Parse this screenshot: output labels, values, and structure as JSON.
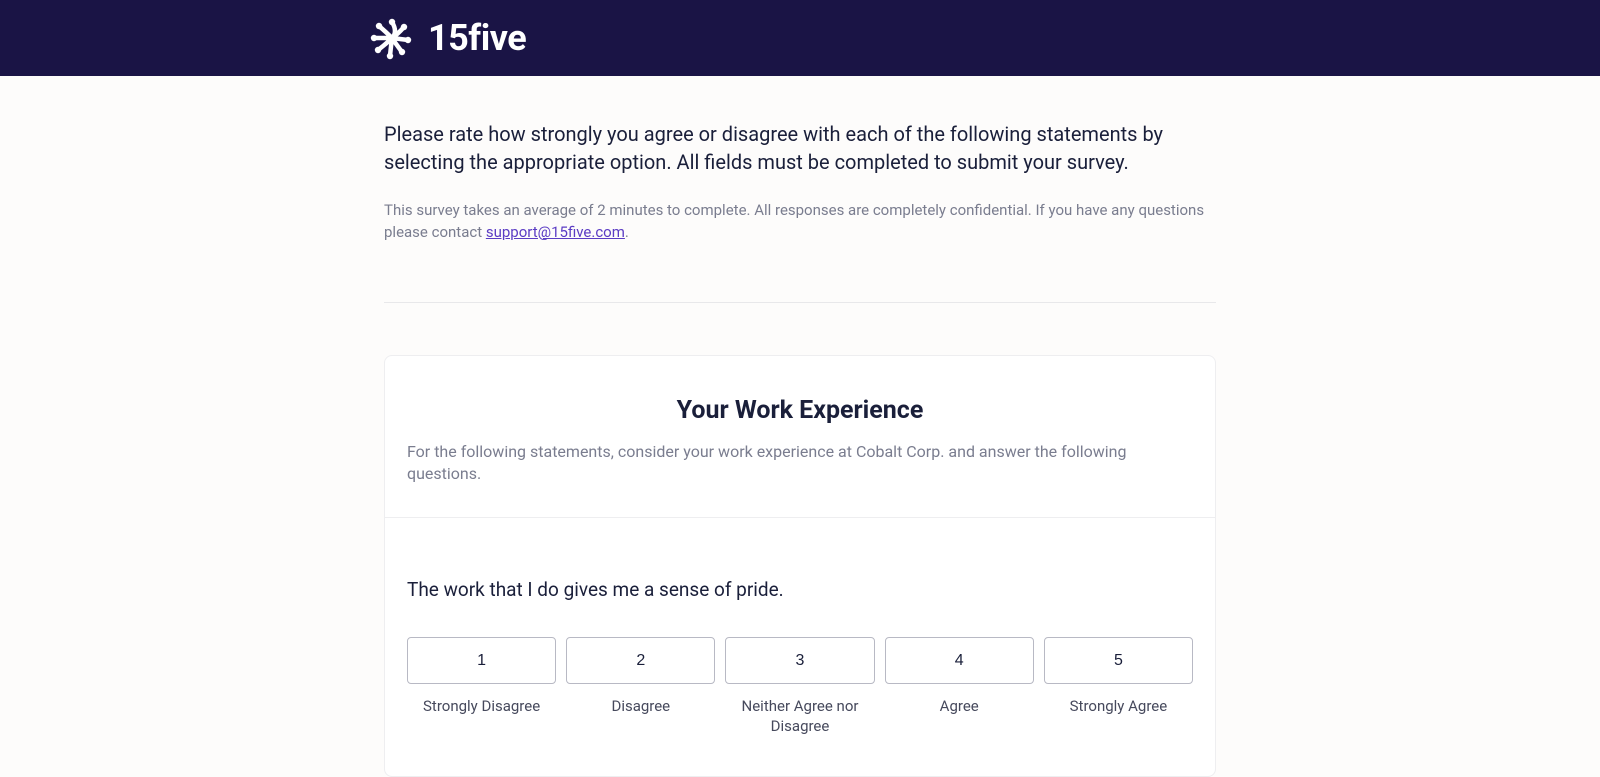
{
  "brand": {
    "name": "15five"
  },
  "intro": {
    "instructions": "Please rate how strongly you agree or disagree with each of the following statements by selecting the appropriate option. All fields must be completed to submit your survey.",
    "meta_prefix": "This survey takes an average of 2 minutes to complete. All responses are completely confidential. If you have any questions please contact ",
    "support_email": "support@15five.com",
    "meta_suffix": "."
  },
  "section": {
    "title": "Your Work Experience",
    "subtitle": "For the following statements, consider your work experience at Cobalt Corp. and answer the following questions."
  },
  "question": {
    "text": "The work that I do gives me a sense of pride.",
    "options": [
      {
        "value": "1",
        "label": "Strongly Disagree"
      },
      {
        "value": "2",
        "label": "Disagree"
      },
      {
        "value": "3",
        "label": "Neither Agree nor Disagree"
      },
      {
        "value": "4",
        "label": "Agree"
      },
      {
        "value": "5",
        "label": "Strongly Agree"
      }
    ]
  }
}
